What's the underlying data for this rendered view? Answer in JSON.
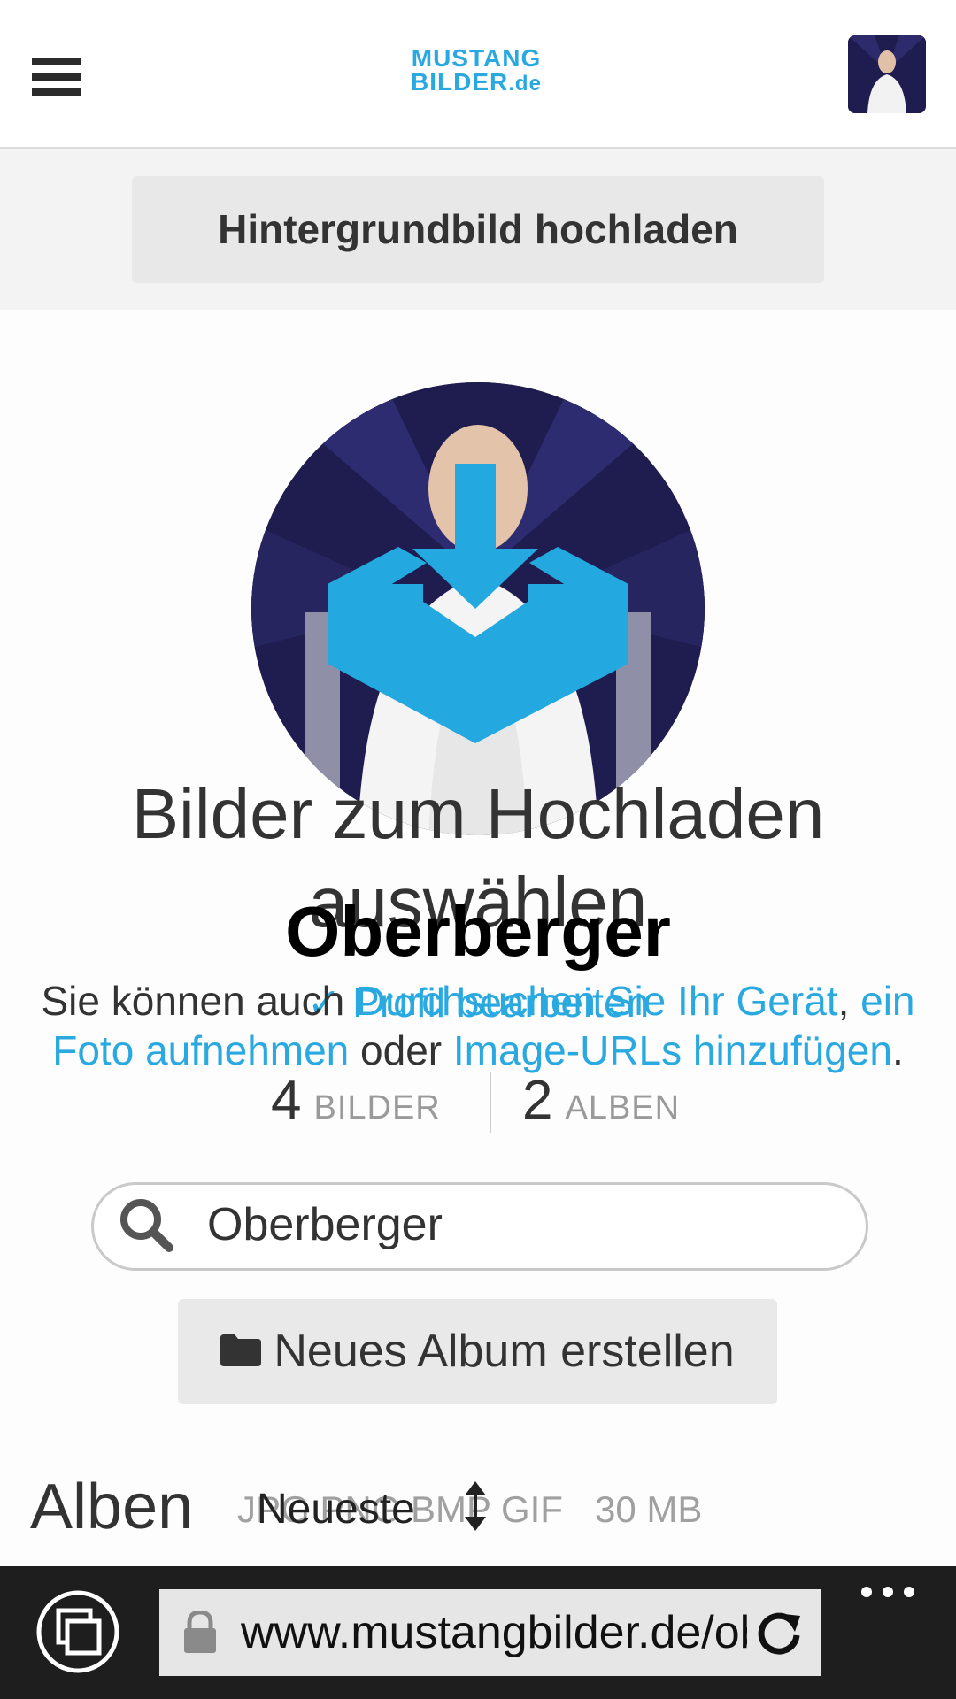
{
  "header": {
    "logo_line1": "MUSTANG",
    "logo_line2": "BILDER",
    "logo_tld": ".de"
  },
  "cover": {
    "upload_label": "Hintergrundbild hochladen"
  },
  "upload": {
    "title": "Bilder zum Hochladen auswählen",
    "desc_prefix": "Sie können auch ",
    "browse_link": "Durchsuchen Sie Ihr Gerät",
    "comma": ",",
    "photo_link": "ein Foto aufnehmen",
    "or": " oder ",
    "urls_link": "Image-URLs hinzufügen",
    "period": ".",
    "formats": "JPG PNG BMP GIF",
    "max_size": "30 MB"
  },
  "profile": {
    "name": "Oberberger",
    "edit_link": "✓ Profil bearbeiten",
    "stats": [
      {
        "value": "4",
        "label": "BILDER"
      },
      {
        "value": "2",
        "label": "ALBEN"
      }
    ]
  },
  "search": {
    "value": "Oberberger"
  },
  "albums": {
    "new_album_label": "Neues Album erstellen",
    "heading": "Alben",
    "sort_label": "Neueste"
  },
  "browser": {
    "url": "www.mustangbilder.de/oberberger"
  },
  "colors": {
    "accent": "#2aa9e0",
    "browser_bar": "#1e1e1e"
  }
}
